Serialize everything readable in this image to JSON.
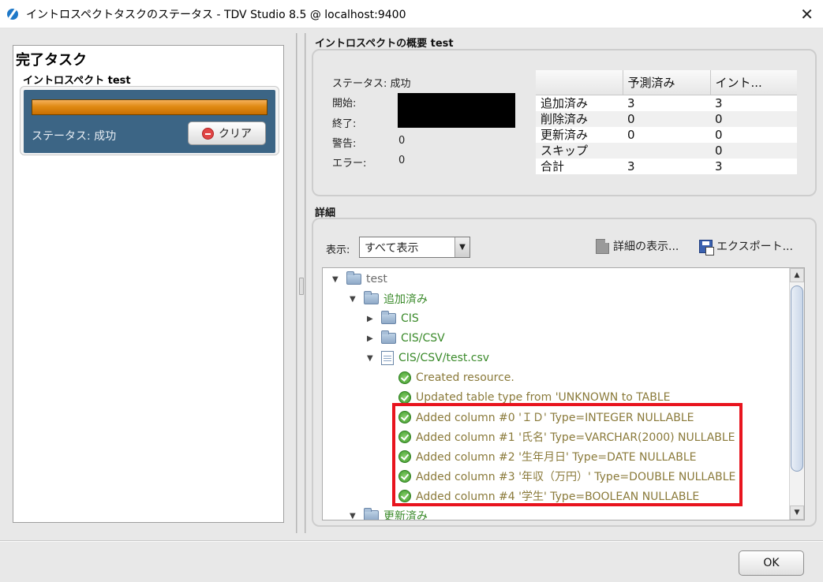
{
  "window": {
    "title": "イントロスペクトタスクのステータス - TDV Studio 8.5 @ localhost:9400",
    "close_icon": "close-icon"
  },
  "left": {
    "heading": "完了タスク",
    "task_name": "イントロスペクト test",
    "progress_fraction": 1.0,
    "status": "ステータス: 成功",
    "clear_label": "クリア"
  },
  "summary": {
    "title": "イントロスペクトの概要  test",
    "status_label": "ステータス: 成功",
    "start_label": "開始:",
    "end_label": "終了:",
    "warnings_label": "警告:",
    "warnings_value": "0",
    "errors_label": "エラー:",
    "errors_value": "0",
    "table": {
      "headers": [
        "",
        "予測済み",
        "イント..."
      ],
      "rows": [
        [
          "追加済み",
          "3",
          "3"
        ],
        [
          "削除済み",
          "0",
          "0"
        ],
        [
          "更新済み",
          "0",
          "0"
        ],
        [
          "スキップ",
          "",
          "0"
        ],
        [
          "合計",
          "3",
          "3"
        ]
      ]
    }
  },
  "details": {
    "title": "詳細",
    "show_label": "表示:",
    "filter_value": "すべて表示",
    "detail_button": "詳細の表示...",
    "export_button": "エクスポート...",
    "tree": [
      {
        "text": "test",
        "icon": "folder-icon",
        "toggle": "▼",
        "style": "root"
      },
      {
        "text": "追加済み",
        "icon": "folder-icon",
        "toggle": "▼",
        "style": "green"
      },
      {
        "text": "CIS",
        "icon": "folder-icon",
        "toggle": "▶",
        "style": "green"
      },
      {
        "text": "CIS/CSV",
        "icon": "folder-icon",
        "toggle": "▶",
        "style": "green"
      },
      {
        "text": "CIS/CSV/test.csv",
        "icon": "file-icon",
        "toggle": "▼",
        "style": "green"
      },
      {
        "text": "Created resource.",
        "icon": "ok-icon",
        "toggle": "",
        "style": "msg"
      },
      {
        "text": "Updated table type from 'UNKNOWN to TABLE",
        "icon": "ok-icon",
        "toggle": "",
        "style": "msg"
      },
      {
        "text": "Added column #0 'ＩＤ' Type=INTEGER NULLABLE",
        "icon": "ok-icon",
        "toggle": "",
        "style": "msg"
      },
      {
        "text": "Added column #1 '氏名' Type=VARCHAR(2000) NULLABLE",
        "icon": "ok-icon",
        "toggle": "",
        "style": "msg"
      },
      {
        "text": "Added column #2 '生年月日' Type=DATE NULLABLE",
        "icon": "ok-icon",
        "toggle": "",
        "style": "msg"
      },
      {
        "text": "Added column #3 '年収（万円）' Type=DOUBLE NULLABLE",
        "icon": "ok-icon",
        "toggle": "",
        "style": "msg"
      },
      {
        "text": "Added column #4 '学生' Type=BOOLEAN NULLABLE",
        "icon": "ok-icon",
        "toggle": "",
        "style": "msg"
      },
      {
        "text": "更新済み",
        "icon": "folder-icon",
        "toggle": "▼",
        "style": "green"
      }
    ]
  },
  "footer": {
    "ok_label": "OK"
  }
}
